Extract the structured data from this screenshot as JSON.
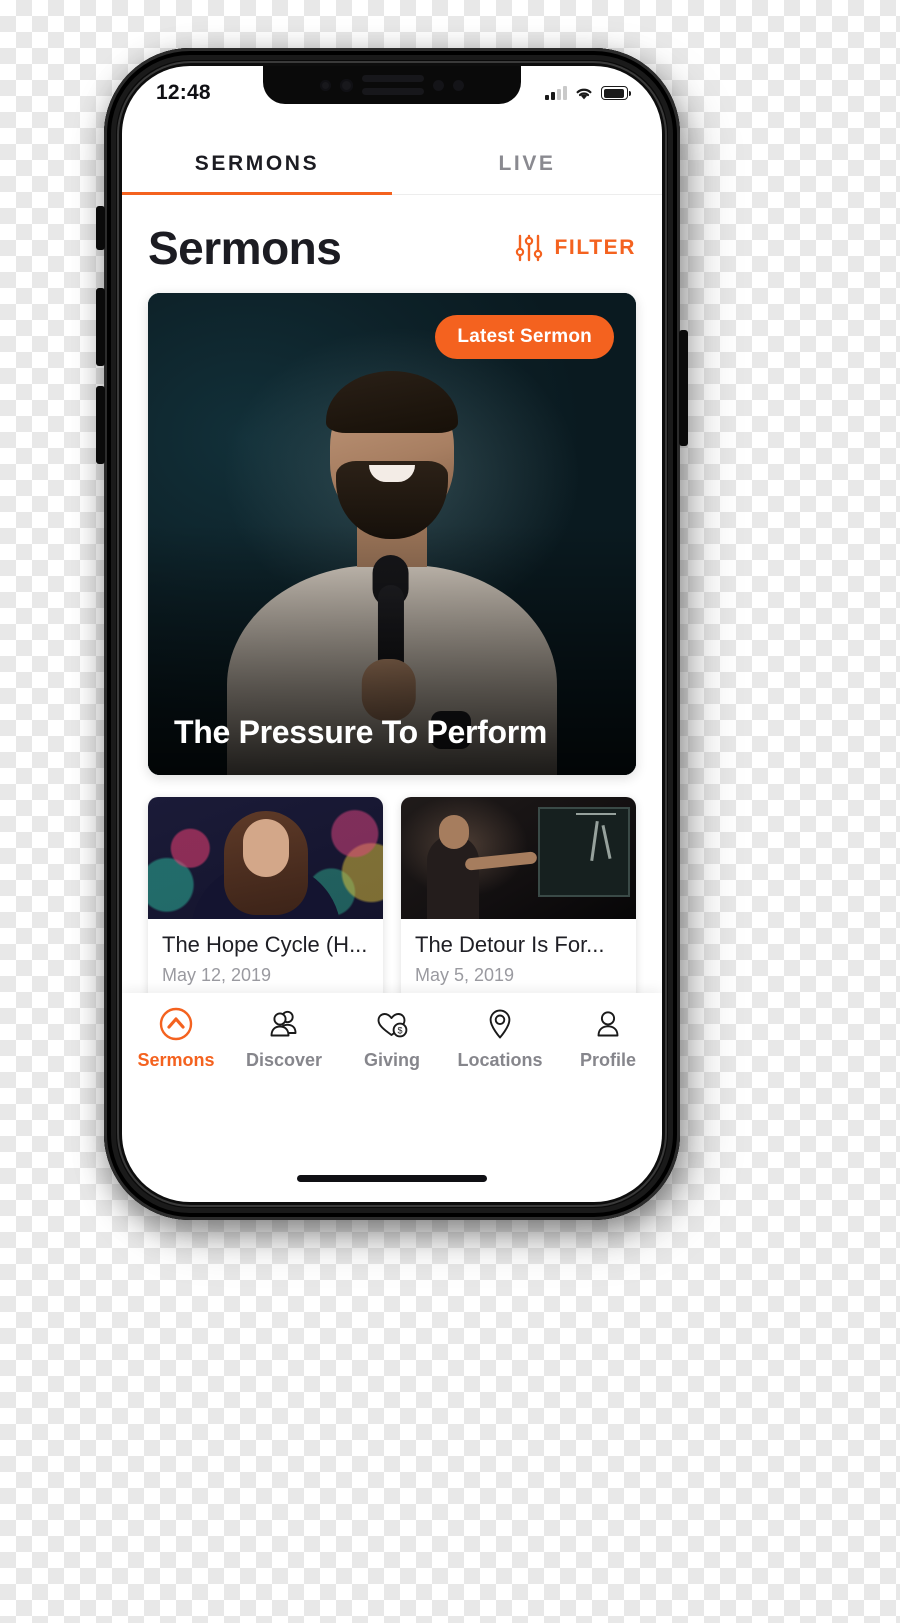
{
  "status_bar": {
    "time": "12:48",
    "signal_icon": "cellular-signal-icon",
    "wifi_icon": "wifi-icon",
    "battery_icon": "battery-icon"
  },
  "top_tabs": {
    "items": [
      {
        "label": "SERMONS",
        "active": true
      },
      {
        "label": "LIVE",
        "active": false
      }
    ]
  },
  "header": {
    "title": "Sermons",
    "filter_label": "FILTER",
    "filter_icon": "sliders-filter-icon"
  },
  "hero": {
    "badge": "Latest Sermon",
    "title": "The Pressure To Perform"
  },
  "sermons": [
    {
      "title": "The Hope Cycle (H...",
      "date": "May 12, 2019"
    },
    {
      "title": "The Detour Is For...",
      "date": "May 5, 2019"
    }
  ],
  "bottom_tabs": {
    "items": [
      {
        "label": "Sermons",
        "icon": "chevron-up-circle-icon",
        "active": true
      },
      {
        "label": "Discover",
        "icon": "people-icon",
        "active": false
      },
      {
        "label": "Giving",
        "icon": "heart-dollar-icon",
        "active": false
      },
      {
        "label": "Locations",
        "icon": "map-pin-icon",
        "active": false
      },
      {
        "label": "Profile",
        "icon": "person-icon",
        "active": false
      }
    ]
  },
  "colors": {
    "accent": "#F4621F",
    "text_dark": "#1C1C22",
    "text_muted": "#86868C",
    "hero_bg": "#102026"
  }
}
